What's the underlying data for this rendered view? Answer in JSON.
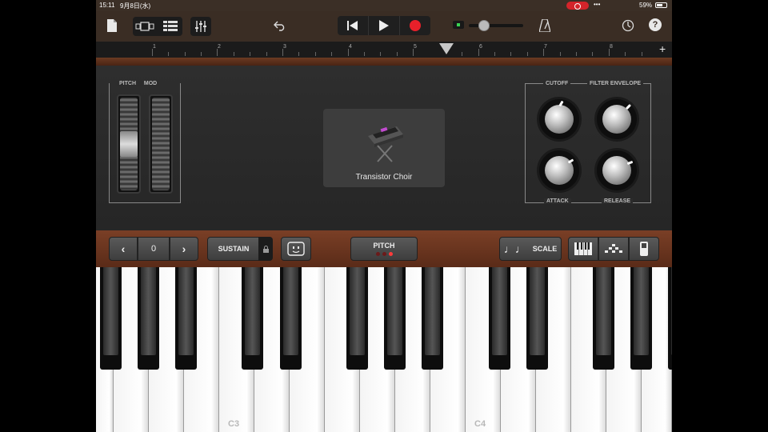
{
  "status_bar": {
    "time": "15:11",
    "date": "9月8日(水)",
    "signal": "•••",
    "battery": "59%"
  },
  "toolbar": {
    "icons": [
      "my-songs-icon",
      "browser-icon",
      "tracks-view-icon",
      "mixer-icon",
      "undo-icon",
      "go-to-beginning-icon",
      "play-icon",
      "record-icon",
      "metronome-icon",
      "settings-icon",
      "help-icon"
    ],
    "help_label": "?",
    "volume_level": 0.2,
    "record_color": "#e8202a"
  },
  "ruler": {
    "bars": [
      "1",
      "2",
      "3",
      "4",
      "5",
      "6",
      "7",
      "8"
    ],
    "add_label": "+"
  },
  "wheels": {
    "pitch_label": "PITCH",
    "mod_label": "MOD"
  },
  "instrument": {
    "name": "Transistor Choir"
  },
  "knobs": {
    "cutoff_label": "CUTOFF",
    "filter_envelope_label": "FILTER ENVELOPE",
    "attack_label": "ATTACK",
    "release_label": "RELEASE"
  },
  "controls": {
    "octave_prev": "‹",
    "octave_value": "0",
    "octave_next": "›",
    "sustain_label": "SUSTAIN",
    "pitch_label": "PITCH",
    "scale_label": "SCALE",
    "scale_icon": "♩♩"
  },
  "keyboard": {
    "labels": [
      "C3",
      "C4"
    ]
  }
}
